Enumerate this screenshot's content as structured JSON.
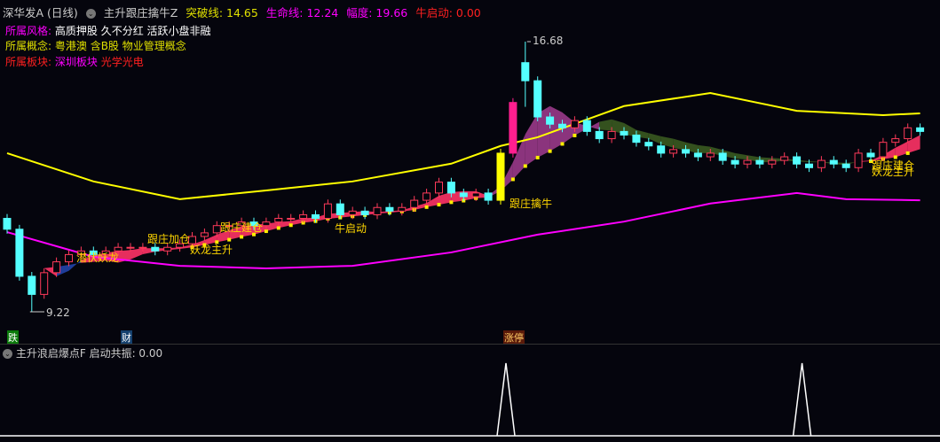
{
  "header": {
    "stock": "深华发A (日线)",
    "indicator": "主升跟庄擒牛Z",
    "breakout_label": "突破线: 14.65",
    "life_label": "生命线: 12.24",
    "range_label": "幅度: 19.66",
    "bull_label": "牛启动: 0.00"
  },
  "info": {
    "style_label": "所属风格:",
    "style_value": "高质押股 久不分红 活跃小盘非融",
    "concept_label": "所属概念:",
    "concept_value": "粤港澳 含B股 物业管理概念",
    "sector_label": "所属板块:",
    "sector_value1": "深圳板块",
    "sector_value2": "光学光电"
  },
  "markers": {
    "high": "16.68",
    "low": "9.22",
    "tag_fall": "跌",
    "tag_finance": "财",
    "tag_limit": "涨停"
  },
  "annotations": [
    "潜伏妖龙",
    "跟庄加仓",
    "妖龙主升",
    "跟庄建仓",
    "牛启动",
    "跟庄擒牛",
    "跟庄建仓",
    "妖龙主升"
  ],
  "indicator_panel": {
    "name": "主升浪启爆点F",
    "value_label": "启动共振: 0.00",
    "spikes": [
      40,
      64
    ]
  },
  "colors": {
    "up": "#ff3a5a",
    "down": "#54ffff",
    "upper": "#ffff00",
    "lower": "#ff00ff",
    "ribbon_up": "#ff3366",
    "ribbon_down": "#2244aa"
  },
  "chart_data": {
    "type": "candlestick",
    "price_range": [
      9.22,
      16.68
    ],
    "closes": [
      11.5,
      10.2,
      9.7,
      10.3,
      10.6,
      10.8,
      10.9,
      10.8,
      10.9,
      11.0,
      11.0,
      11.0,
      10.9,
      11.0,
      11.1,
      11.3,
      11.4,
      11.6,
      11.6,
      11.7,
      11.6,
      11.7,
      11.8,
      11.8,
      11.9,
      11.8,
      12.2,
      11.9,
      12.0,
      11.9,
      12.1,
      12.0,
      12.1,
      12.3,
      12.5,
      12.8,
      12.5,
      12.4,
      12.5,
      12.3,
      13.6,
      15.0,
      15.6,
      14.6,
      14.4,
      14.3,
      14.5,
      14.2,
      14.0,
      14.2,
      14.1,
      13.9,
      13.8,
      13.6,
      13.7,
      13.6,
      13.5,
      13.6,
      13.4,
      13.3,
      13.4,
      13.3,
      13.4,
      13.5,
      13.3,
      13.2,
      13.4,
      13.3,
      13.2,
      13.6,
      13.5,
      13.9,
      14.0,
      14.3,
      14.2
    ],
    "upper_line": [
      [
        0,
        13.6
      ],
      [
        7,
        12.82
      ],
      [
        14,
        12.33
      ],
      [
        21,
        12.57
      ],
      [
        28,
        12.82
      ],
      [
        36,
        13.31
      ],
      [
        40,
        13.8
      ],
      [
        43,
        14.04
      ],
      [
        50,
        14.9
      ],
      [
        57,
        15.26
      ],
      [
        64,
        14.77
      ],
      [
        71,
        14.65
      ],
      [
        74,
        14.7
      ]
    ],
    "lower_line": [
      [
        0,
        11.42
      ],
      [
        7,
        10.74
      ],
      [
        14,
        10.49
      ],
      [
        21,
        10.42
      ],
      [
        28,
        10.49
      ],
      [
        36,
        10.86
      ],
      [
        43,
        11.35
      ],
      [
        50,
        11.71
      ],
      [
        57,
        12.21
      ],
      [
        64,
        12.5
      ],
      [
        68,
        12.33
      ],
      [
        74,
        12.3
      ]
    ]
  }
}
